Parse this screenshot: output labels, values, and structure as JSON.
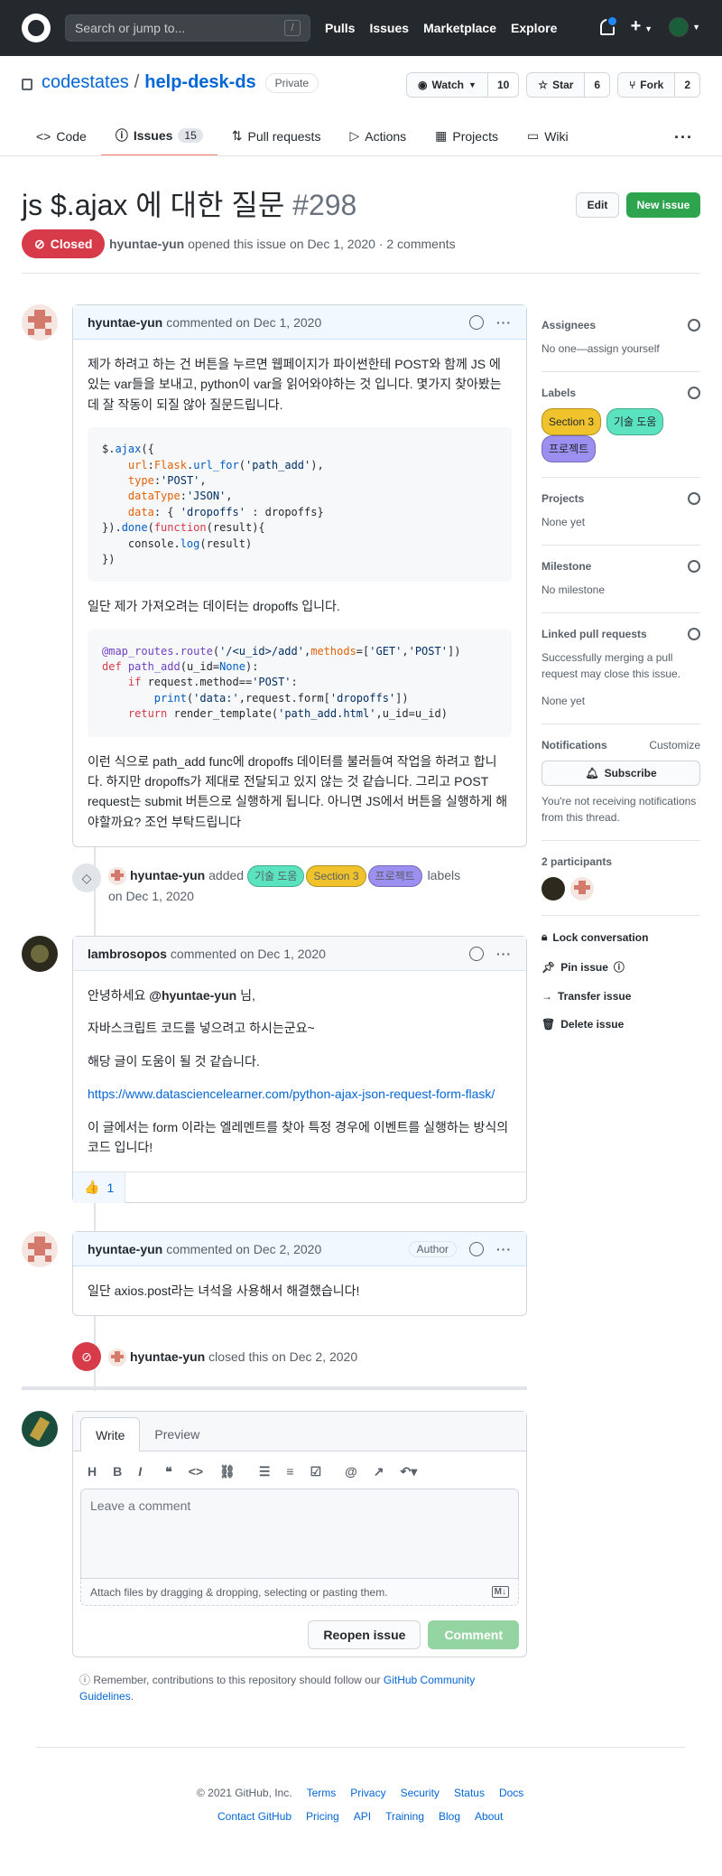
{
  "header": {
    "search_placeholder": "Search or jump to...",
    "search_key": "/",
    "nav": [
      "Pulls",
      "Issues",
      "Marketplace",
      "Explore"
    ]
  },
  "repo": {
    "owner": "codestates",
    "sep": "/",
    "name": "help-desk-ds",
    "visibility": "Private",
    "watch": {
      "label": "Watch",
      "count": "10"
    },
    "star": {
      "label": "Star",
      "count": "6"
    },
    "fork": {
      "label": "Fork",
      "count": "2"
    }
  },
  "tabs": [
    {
      "label": "Code"
    },
    {
      "label": "Issues",
      "count": "15"
    },
    {
      "label": "Pull requests"
    },
    {
      "label": "Actions"
    },
    {
      "label": "Projects"
    },
    {
      "label": "Wiki"
    }
  ],
  "issue": {
    "title": "js $.ajax 에 대한 질문",
    "number": "#298",
    "edit": "Edit",
    "new_issue": "New issue",
    "state": "Closed",
    "author": "hyuntae-yun",
    "meta": "opened this issue on Dec 1, 2020 · 2 comments"
  },
  "comments": [
    {
      "author": "hyuntae-yun",
      "meta": "commented on Dec 1, 2020",
      "p1": "제가 하려고 하는 건 버튼을 누르면 웹페이지가 파이썬한테 POST와 함께 JS 에 있는 var들을 보내고, python이 var을 읽어와야하는 것 입니다. 몇가지 찾아봤는데 잘 작동이 되질 않아 질문드립니다.",
      "code1": "$.ajax({\n    url:Flask.url_for('path_add'),\n    type:'POST',\n    dataType:'JSON',\n    data: { 'dropoffs' : dropoffs}\n}).done(function(result){\n    console.log(result)\n})",
      "p2": "일단 제가 가져오려는 데이터는 dropoffs 입니다.",
      "code2": "@map_routes.route('/<u_id>/add',methods=['GET','POST'])\ndef path_add(u_id=None):\n    if request.method=='POST':\n        print('data:',request.form['dropoffs'])\n    return render_template('path_add.html',u_id=u_id)",
      "p3": "이런 식으로 path_add func에 dropoffs 데이터를 불러들여 작업을 하려고 합니다. 하지만 dropoffs가 제대로 전달되고 있지 않는 것 같습니다. 그리고 POST request는 submit 버튼으로 실행하게 됩니다. 아니면 JS에서 버튼을 실행하게 해야할까요? 조언 부탁드립니다"
    },
    {
      "author": "lambrosopos",
      "meta": "commented on Dec 1, 2020",
      "greet_pre": "안녕하세요",
      "mention": "@hyuntae-yun",
      "greet_post": "님,",
      "p1": "자바스크립트 코드를 넣으려고 하시는군요~",
      "p2": "해당 글이 도움이 될 것 같습니다.",
      "link": "https://www.datasciencelearner.com/python-ajax-json-request-form-flask/",
      "p3": "이 글에서는 form 이라는 엘레멘트를 찾아 특정 경우에 이벤트를 실행하는 방식의 코드 입니다!",
      "reaction_emoji": "👍",
      "reaction_count": "1"
    },
    {
      "author": "hyuntae-yun",
      "meta": "commented on Dec 2, 2020",
      "badge": "Author",
      "p1": "일단 axios.post라는 녀석을 사용해서 해결했습니다!"
    }
  ],
  "events": {
    "labeled": {
      "actor": "hyuntae-yun",
      "verb": "added",
      "labels": [
        {
          "name": "기술 도움",
          "color": "#5be3c0"
        },
        {
          "name": "Section 3",
          "color": "#f0c22b"
        },
        {
          "name": "프로젝트",
          "color": "#9b8ff0"
        }
      ],
      "noun": "labels",
      "date": "on Dec 1, 2020"
    },
    "closed": {
      "actor": "hyuntae-yun",
      "text": "closed this on Dec 2, 2020"
    }
  },
  "sidebar": {
    "assignees": {
      "title": "Assignees",
      "text": "No one—assign yourself"
    },
    "labels": {
      "title": "Labels",
      "items": [
        {
          "name": "Section 3",
          "color": "#f0c22b"
        },
        {
          "name": "기술 도움",
          "color": "#5be3c0"
        },
        {
          "name": "프로젝트",
          "color": "#9b8ff0"
        }
      ]
    },
    "projects": {
      "title": "Projects",
      "text": "None yet"
    },
    "milestone": {
      "title": "Milestone",
      "text": "No milestone"
    },
    "linked": {
      "title": "Linked pull requests",
      "text": "Successfully merging a pull request may close this issue.",
      "text2": "None yet"
    },
    "notifications": {
      "title": "Notifications",
      "customize": "Customize",
      "button": "Subscribe",
      "text": "You're not receiving notifications from this thread."
    },
    "participants": {
      "title": "2 participants"
    },
    "actions": [
      "Lock conversation",
      "Pin issue",
      "Transfer issue",
      "Delete issue"
    ]
  },
  "form": {
    "tab_write": "Write",
    "tab_preview": "Preview",
    "placeholder": "Leave a comment",
    "attach": "Attach files by dragging & dropping, selecting or pasting them.",
    "markdown": "M↓",
    "reopen": "Reopen issue",
    "comment": "Comment",
    "guide_pre": "Remember, contributions to this repository should follow our",
    "guide_link": "GitHub Community Guidelines",
    "guide_post": "."
  },
  "footer": {
    "copyright": "© 2021 GitHub, Inc.",
    "row1": [
      "Terms",
      "Privacy",
      "Security",
      "Status",
      "Docs"
    ],
    "row2": [
      "Contact GitHub",
      "Pricing",
      "API",
      "Training",
      "Blog",
      "About"
    ]
  }
}
